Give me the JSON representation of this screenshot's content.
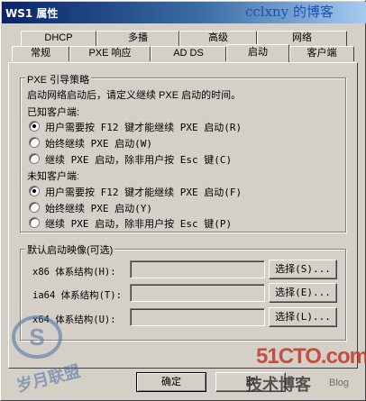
{
  "window": {
    "title": "WS1 属性",
    "watermark": "cclxny 的博客"
  },
  "tabs_row1": [
    "DHCP",
    "多播",
    "高级",
    "网络"
  ],
  "tabs_row2": [
    "常规",
    "PXE 响应",
    "AD DS",
    "启动",
    "客户端"
  ],
  "active_tab": "启动",
  "pxe": {
    "group_title": "PXE 引导策略",
    "description": "启动网络启动后，请定义继续 PXE 启动的时间。",
    "known_label": "已知客户端:",
    "known_options": [
      {
        "label": "用户需要按 F12 键才能继续 PXE 启动(R)",
        "checked": true
      },
      {
        "label": "始终继续 PXE 启动(W)",
        "checked": false
      },
      {
        "label": "继续 PXE 启动，除非用户按 Esc 键(C)",
        "checked": false
      }
    ],
    "unknown_label": "未知客户端:",
    "unknown_options": [
      {
        "label": "用户需要按 F12 键才能继续 PXE 启动(F)",
        "checked": true
      },
      {
        "label": "始终继续 PXE 启动(Y)",
        "checked": false
      },
      {
        "label": "继续 PXE 启动，除非用户按 Esc 键(P)",
        "checked": false
      }
    ]
  },
  "boot_image": {
    "group_title": "默认启动映像(可选)",
    "rows": [
      {
        "label": "x86 体系结构(H):",
        "value": "",
        "button": "选择(S)..."
      },
      {
        "label": "ia64 体系结构(T):",
        "value": "",
        "button": "选择(E)..."
      },
      {
        "label": "x64 体系结构(U):",
        "value": "",
        "button": "选择(L)..."
      }
    ]
  },
  "footer": {
    "ok": "确定",
    "cancel": "取"
  },
  "logos": {
    "site_mark": "51CTO.com",
    "site_sub": "技术博客",
    "site_blog": "Blog",
    "seal_text": "岁月联盟"
  },
  "colors": {
    "titlebar_start": "#0a246a",
    "titlebar_end": "#a6caf0",
    "face": "#d4d0c8"
  }
}
